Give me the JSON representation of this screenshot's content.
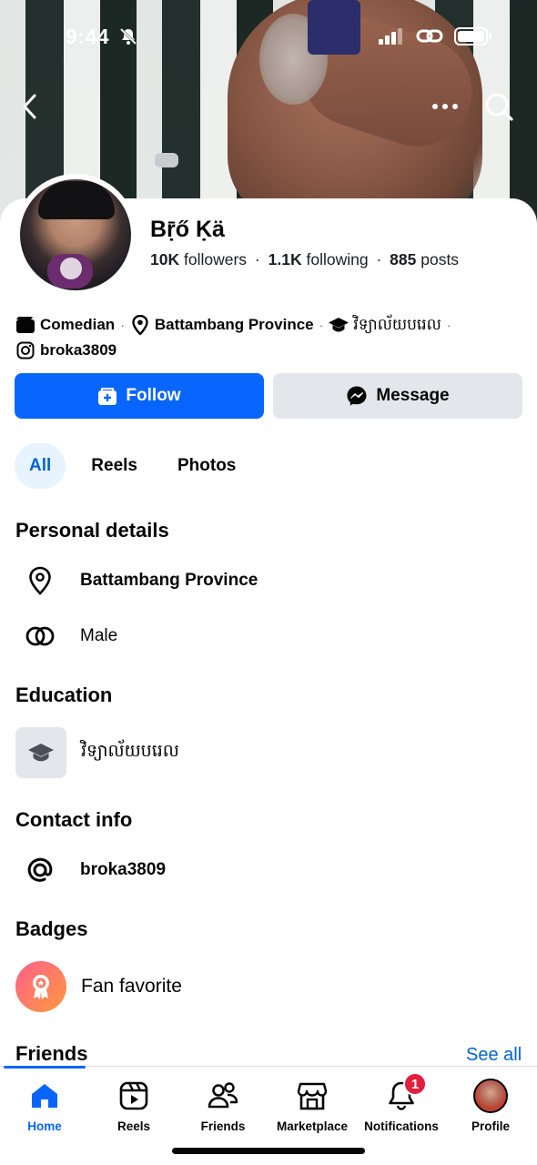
{
  "status_bar": {
    "time": "9:44"
  },
  "profile": {
    "name": "Bṝő Ḳä",
    "followers_count": "10K",
    "followers_label": "followers",
    "following_count": "1.1K",
    "following_label": "following",
    "posts_count": "885",
    "posts_label": "posts",
    "separator": "·"
  },
  "intro": {
    "occupation": "Comedian",
    "location": "Battambang Province",
    "school": "វិទ្យាល័យបរេល",
    "instagram": "broka3809"
  },
  "actions": {
    "follow_label": "Follow",
    "message_label": "Message"
  },
  "tabs": [
    {
      "label": "All",
      "active": true
    },
    {
      "label": "Reels",
      "active": false
    },
    {
      "label": "Photos",
      "active": false
    }
  ],
  "personal_details": {
    "title": "Personal details",
    "location": "Battambang Province",
    "gender": "Male"
  },
  "education": {
    "title": "Education",
    "school": "វិទ្យាល័យបរេល"
  },
  "contact_info": {
    "title": "Contact info",
    "instagram": "broka3809"
  },
  "badges": {
    "title": "Badges",
    "badge": "Fan favorite"
  },
  "friends": {
    "title": "Friends",
    "see_all": "See all"
  },
  "nav": {
    "items": [
      {
        "label": "Home",
        "icon": "home-icon",
        "active": true
      },
      {
        "label": "Reels",
        "icon": "reels-icon"
      },
      {
        "label": "Friends",
        "icon": "friends-icon"
      },
      {
        "label": "Marketplace",
        "icon": "marketplace-icon"
      },
      {
        "label": "Notifications",
        "icon": "bell-icon",
        "badge": "1"
      },
      {
        "label": "Profile",
        "icon": "profile-thumbnail"
      }
    ]
  },
  "colors": {
    "primary": "#0866ff",
    "link": "#0064d1",
    "tab_active_bg": "#e7f3ff",
    "badge_red": "#e41e3f",
    "button_gray": "#e4e6eb"
  }
}
